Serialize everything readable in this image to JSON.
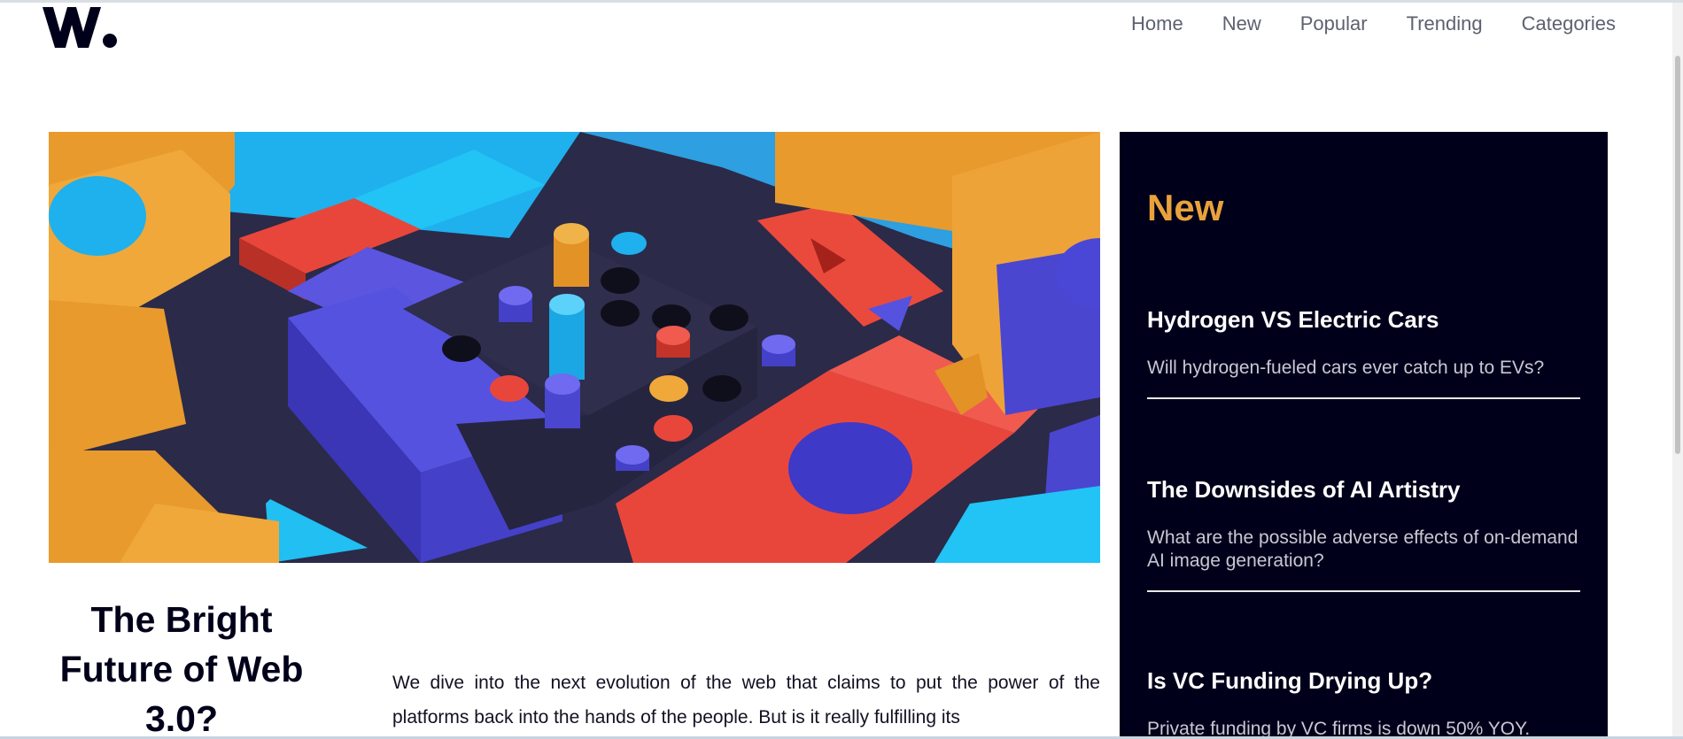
{
  "brand": {
    "logo_text": "W."
  },
  "nav": {
    "items": [
      {
        "label": "Home"
      },
      {
        "label": "New"
      },
      {
        "label": "Popular"
      },
      {
        "label": "Trending"
      },
      {
        "label": "Categories"
      }
    ]
  },
  "sidebar": {
    "title": "New",
    "items": [
      {
        "title": "Hydrogen VS Electric Cars",
        "summary": "Will hydrogen-fueled cars ever catch up to EVs?"
      },
      {
        "title": "The Downsides of AI Artistry",
        "summary": "What are the possible adverse effects of on-demand AI image generation?"
      },
      {
        "title": "Is VC Funding Drying Up?",
        "summary": "Private funding by VC firms is down 50% YOY."
      }
    ]
  },
  "article": {
    "headline": "The Bright Future of Web 3.0?",
    "lead": "We dive into the next evolution of the web that claims to put the power of the platforms back into the hands of the people. But is it really fulfilling its"
  },
  "colors": {
    "accent": "#e9a23b",
    "sidebar_bg": "#00001a",
    "nav_text": "#5d6170",
    "heading": "#00001a"
  }
}
